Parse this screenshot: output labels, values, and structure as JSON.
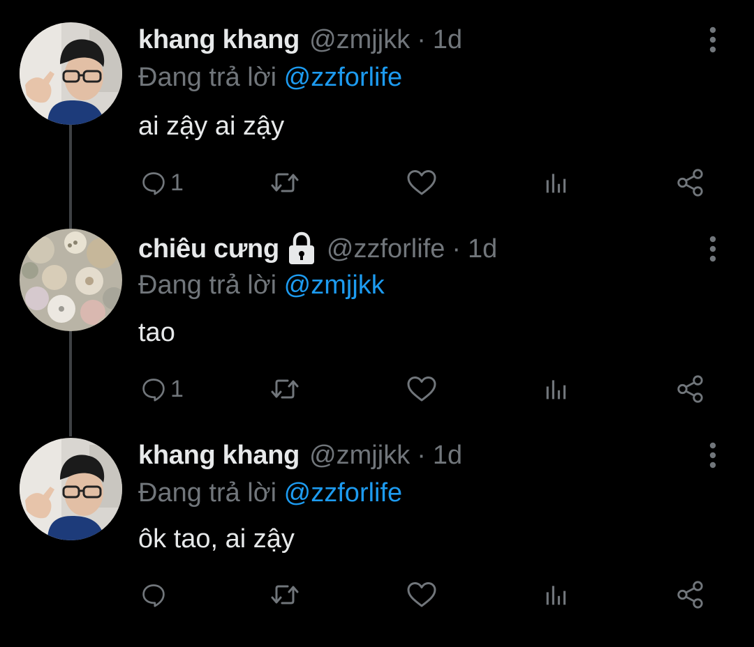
{
  "colors": {
    "background": "#000000",
    "text": "#e7e9ea",
    "secondary": "#71767b",
    "link": "#1d9bf0",
    "thread_line": "#3e4144"
  },
  "tweets": [
    {
      "display_name": "khang khang",
      "handle": "@zmjjkk",
      "separator": "·",
      "time": "1d",
      "replying_prefix": "Đang trả lời",
      "replying_to": "@zzforlife",
      "text": "ai zậy ai zậy",
      "reply_count": "1",
      "locked": false,
      "avatar": "person-with-glasses-avatar"
    },
    {
      "display_name": "chiêu cưng",
      "handle": "@zzforlife",
      "separator": "·",
      "time": "1d",
      "replying_prefix": "Đang trả lời",
      "replying_to": "@zmjjkk",
      "text": "tao",
      "reply_count": "1",
      "locked": true,
      "avatar": "buttons-collection-avatar"
    },
    {
      "display_name": "khang khang",
      "handle": "@zmjjkk",
      "separator": "·",
      "time": "1d",
      "replying_prefix": "Đang trả lời",
      "replying_to": "@zzforlife",
      "text": "ôk tao, ai zậy",
      "reply_count": "",
      "locked": false,
      "avatar": "person-with-glasses-avatar"
    }
  ],
  "icons": {
    "reply": "reply-icon",
    "retweet": "retweet-icon",
    "like": "heart-icon",
    "views": "analytics-icon",
    "share": "share-icon",
    "more": "more-vertical-icon",
    "lock": "lock-icon"
  }
}
